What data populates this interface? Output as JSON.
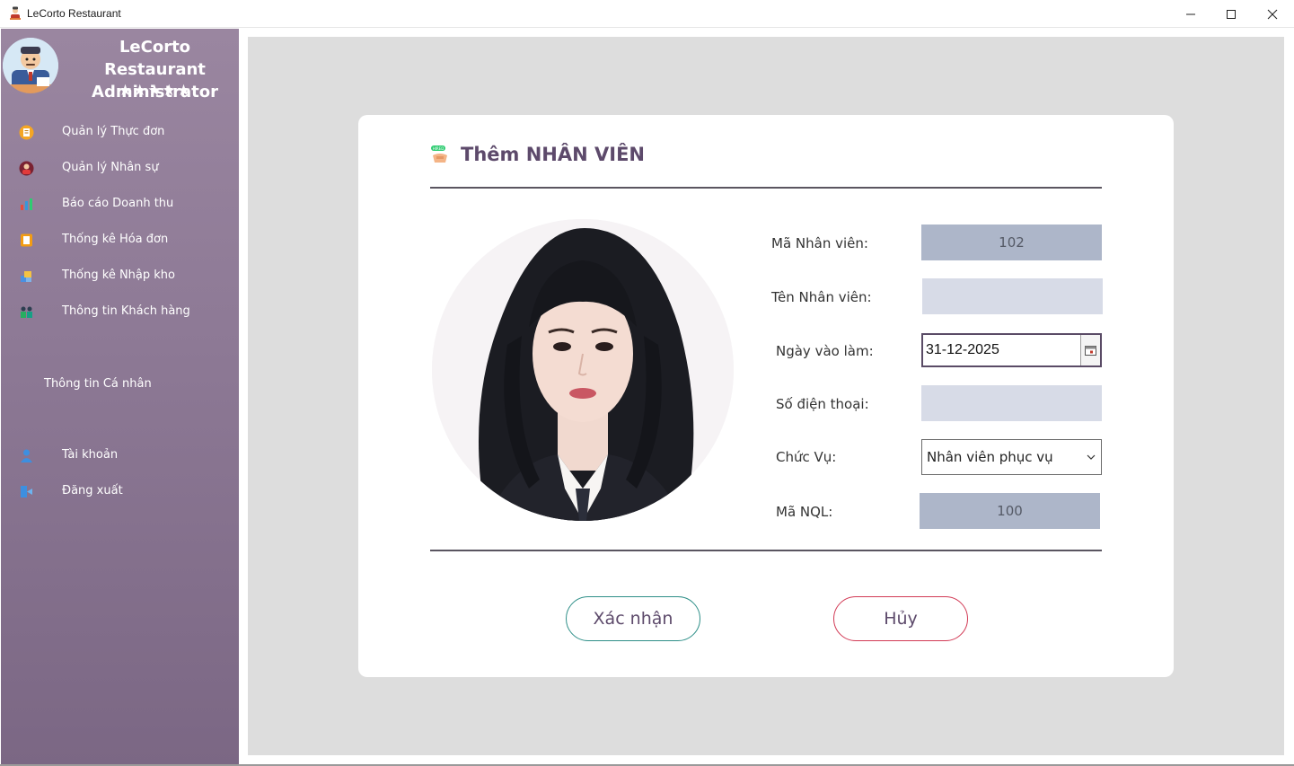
{
  "window": {
    "title": "LeCorto Restaurant",
    "controls": {
      "minimize": "minimize-icon",
      "maximize": "maximize-icon",
      "close": "close-icon"
    }
  },
  "sidebar": {
    "admin_name_line1": "LeCorto Restaurant",
    "admin_name_line2": "Administrator",
    "stars": "★★★★★",
    "items": [
      {
        "label": "Quản lý Thực đơn",
        "icon": "menu-book-icon"
      },
      {
        "label": "Quản lý Nhân sự",
        "icon": "staff-icon"
      },
      {
        "label": "Báo cáo Doanh thu",
        "icon": "revenue-chart-icon"
      },
      {
        "label": "Thống kê Hóa đơn",
        "icon": "invoice-icon"
      },
      {
        "label": "Thống kê Nhập kho",
        "icon": "warehouse-icon"
      },
      {
        "label": "Thông tin Khách hàng",
        "icon": "customers-icon"
      }
    ],
    "personal_section": "Thông tin Cá nhân",
    "account_items": [
      {
        "label": "Tài khoản",
        "icon": "account-icon"
      },
      {
        "label": "Đăng xuất",
        "icon": "logout-icon"
      }
    ]
  },
  "form": {
    "title": "Thêm NHÂN VIÊN",
    "title_icon": "hired-icon",
    "fields": {
      "employee_id_label": "Mã Nhân viên:",
      "employee_id_value": "102",
      "employee_name_label": "Tên Nhân viên:",
      "employee_name_value": "",
      "start_date_label": "Ngày vào làm:",
      "start_date_value": "31-12-2025",
      "phone_label": "Số điện thoại:",
      "phone_value": "",
      "position_label": "Chức Vụ:",
      "position_value": "Nhân viên phục vụ",
      "manager_id_label": "Mã NQL:",
      "manager_id_value": "100"
    },
    "confirm_label": "Xác nhận",
    "cancel_label": "Hủy"
  },
  "colors": {
    "sidebar_top": "#9a86a0",
    "sidebar_bottom": "#7b6784",
    "accent_title": "#5d4a6b",
    "confirm_border": "#2e8f88",
    "cancel_border": "#d23a55",
    "readonly_field": "#adb6c9",
    "empty_field": "#d7dbe7"
  }
}
